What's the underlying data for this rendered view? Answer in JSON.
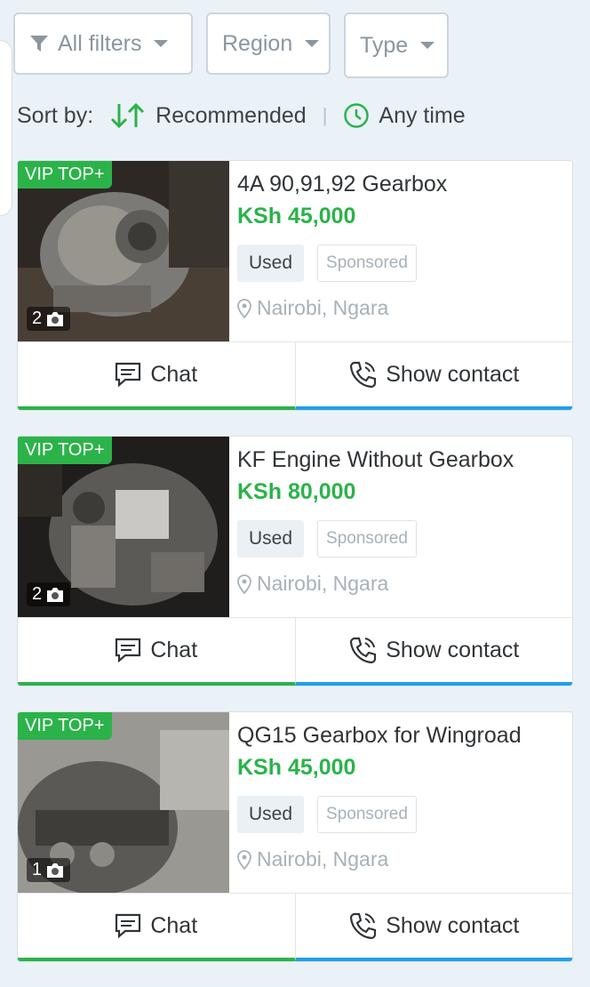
{
  "filters": {
    "all_label": "All filters",
    "region_label": "Region",
    "type_label": "Type"
  },
  "sort": {
    "prefix": "Sort by:",
    "value": "Recommended",
    "time_value": "Any time"
  },
  "colors": {
    "accent_green": "#2bb34a",
    "accent_blue": "#1f9fe8"
  },
  "listings": [
    {
      "badge": "VIP TOP+",
      "photo_count": "2",
      "title": "4A 90,91,92 Gearbox",
      "price": "KSh 45,000",
      "condition": "Used",
      "sponsored": "Sponsored",
      "location": "Nairobi, Ngara",
      "chat_label": "Chat",
      "contact_label": "Show contact"
    },
    {
      "badge": "VIP TOP+",
      "photo_count": "2",
      "title": "KF Engine Without Gearbox",
      "price": "KSh 80,000",
      "condition": "Used",
      "sponsored": "Sponsored",
      "location": "Nairobi, Ngara",
      "chat_label": "Chat",
      "contact_label": "Show contact"
    },
    {
      "badge": "VIP TOP+",
      "photo_count": "1",
      "title": "QG15 Gearbox for Wingroad",
      "price": "KSh 45,000",
      "condition": "Used",
      "sponsored": "Sponsored",
      "location": "Nairobi, Ngara",
      "chat_label": "Chat",
      "contact_label": "Show contact"
    }
  ]
}
